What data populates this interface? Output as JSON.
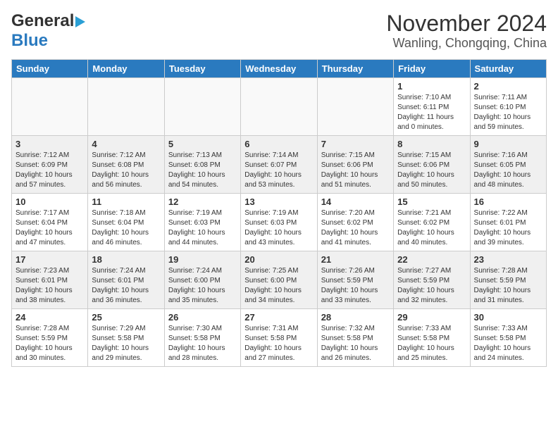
{
  "header": {
    "logo_line1": "General",
    "logo_line2": "Blue",
    "title": "November 2024",
    "subtitle": "Wanling, Chongqing, China"
  },
  "weekdays": [
    "Sunday",
    "Monday",
    "Tuesday",
    "Wednesday",
    "Thursday",
    "Friday",
    "Saturday"
  ],
  "weeks": [
    [
      {
        "day": "",
        "info": ""
      },
      {
        "day": "",
        "info": ""
      },
      {
        "day": "",
        "info": ""
      },
      {
        "day": "",
        "info": ""
      },
      {
        "day": "",
        "info": ""
      },
      {
        "day": "1",
        "info": "Sunrise: 7:10 AM\nSunset: 6:11 PM\nDaylight: 11 hours\nand 0 minutes."
      },
      {
        "day": "2",
        "info": "Sunrise: 7:11 AM\nSunset: 6:10 PM\nDaylight: 10 hours\nand 59 minutes."
      }
    ],
    [
      {
        "day": "3",
        "info": "Sunrise: 7:12 AM\nSunset: 6:09 PM\nDaylight: 10 hours\nand 57 minutes."
      },
      {
        "day": "4",
        "info": "Sunrise: 7:12 AM\nSunset: 6:08 PM\nDaylight: 10 hours\nand 56 minutes."
      },
      {
        "day": "5",
        "info": "Sunrise: 7:13 AM\nSunset: 6:08 PM\nDaylight: 10 hours\nand 54 minutes."
      },
      {
        "day": "6",
        "info": "Sunrise: 7:14 AM\nSunset: 6:07 PM\nDaylight: 10 hours\nand 53 minutes."
      },
      {
        "day": "7",
        "info": "Sunrise: 7:15 AM\nSunset: 6:06 PM\nDaylight: 10 hours\nand 51 minutes."
      },
      {
        "day": "8",
        "info": "Sunrise: 7:15 AM\nSunset: 6:06 PM\nDaylight: 10 hours\nand 50 minutes."
      },
      {
        "day": "9",
        "info": "Sunrise: 7:16 AM\nSunset: 6:05 PM\nDaylight: 10 hours\nand 48 minutes."
      }
    ],
    [
      {
        "day": "10",
        "info": "Sunrise: 7:17 AM\nSunset: 6:04 PM\nDaylight: 10 hours\nand 47 minutes."
      },
      {
        "day": "11",
        "info": "Sunrise: 7:18 AM\nSunset: 6:04 PM\nDaylight: 10 hours\nand 46 minutes."
      },
      {
        "day": "12",
        "info": "Sunrise: 7:19 AM\nSunset: 6:03 PM\nDaylight: 10 hours\nand 44 minutes."
      },
      {
        "day": "13",
        "info": "Sunrise: 7:19 AM\nSunset: 6:03 PM\nDaylight: 10 hours\nand 43 minutes."
      },
      {
        "day": "14",
        "info": "Sunrise: 7:20 AM\nSunset: 6:02 PM\nDaylight: 10 hours\nand 41 minutes."
      },
      {
        "day": "15",
        "info": "Sunrise: 7:21 AM\nSunset: 6:02 PM\nDaylight: 10 hours\nand 40 minutes."
      },
      {
        "day": "16",
        "info": "Sunrise: 7:22 AM\nSunset: 6:01 PM\nDaylight: 10 hours\nand 39 minutes."
      }
    ],
    [
      {
        "day": "17",
        "info": "Sunrise: 7:23 AM\nSunset: 6:01 PM\nDaylight: 10 hours\nand 38 minutes."
      },
      {
        "day": "18",
        "info": "Sunrise: 7:24 AM\nSunset: 6:01 PM\nDaylight: 10 hours\nand 36 minutes."
      },
      {
        "day": "19",
        "info": "Sunrise: 7:24 AM\nSunset: 6:00 PM\nDaylight: 10 hours\nand 35 minutes."
      },
      {
        "day": "20",
        "info": "Sunrise: 7:25 AM\nSunset: 6:00 PM\nDaylight: 10 hours\nand 34 minutes."
      },
      {
        "day": "21",
        "info": "Sunrise: 7:26 AM\nSunset: 5:59 PM\nDaylight: 10 hours\nand 33 minutes."
      },
      {
        "day": "22",
        "info": "Sunrise: 7:27 AM\nSunset: 5:59 PM\nDaylight: 10 hours\nand 32 minutes."
      },
      {
        "day": "23",
        "info": "Sunrise: 7:28 AM\nSunset: 5:59 PM\nDaylight: 10 hours\nand 31 minutes."
      }
    ],
    [
      {
        "day": "24",
        "info": "Sunrise: 7:28 AM\nSunset: 5:59 PM\nDaylight: 10 hours\nand 30 minutes."
      },
      {
        "day": "25",
        "info": "Sunrise: 7:29 AM\nSunset: 5:58 PM\nDaylight: 10 hours\nand 29 minutes."
      },
      {
        "day": "26",
        "info": "Sunrise: 7:30 AM\nSunset: 5:58 PM\nDaylight: 10 hours\nand 28 minutes."
      },
      {
        "day": "27",
        "info": "Sunrise: 7:31 AM\nSunset: 5:58 PM\nDaylight: 10 hours\nand 27 minutes."
      },
      {
        "day": "28",
        "info": "Sunrise: 7:32 AM\nSunset: 5:58 PM\nDaylight: 10 hours\nand 26 minutes."
      },
      {
        "day": "29",
        "info": "Sunrise: 7:33 AM\nSunset: 5:58 PM\nDaylight: 10 hours\nand 25 minutes."
      },
      {
        "day": "30",
        "info": "Sunrise: 7:33 AM\nSunset: 5:58 PM\nDaylight: 10 hours\nand 24 minutes."
      }
    ]
  ]
}
